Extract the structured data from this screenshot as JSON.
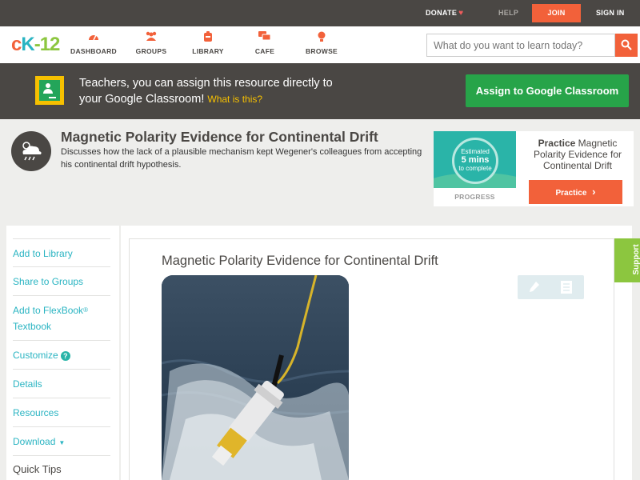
{
  "topbar": {
    "donate": "DONATE",
    "help": "HELP",
    "join": "JOIN",
    "signin": "SIGN IN"
  },
  "brand": {
    "logo_c": "c",
    "logo_k": "K",
    "logo_rest": "-12"
  },
  "nav": {
    "items": [
      {
        "label": "DASHBOARD",
        "icon": "dashboard-icon"
      },
      {
        "label": "GROUPS",
        "icon": "groups-icon"
      },
      {
        "label": "LIBRARY",
        "icon": "library-icon"
      },
      {
        "label": "CAFE",
        "icon": "cafe-icon"
      },
      {
        "label": "BROWSE",
        "icon": "browse-icon"
      }
    ],
    "search_placeholder": "What do you want to learn today?"
  },
  "banner": {
    "line1": "Teachers, you can assign this resource directly to",
    "line2": "your Google Classroom!",
    "what_link": "What is this?",
    "assign_button": "Assign to Google Classroom"
  },
  "header": {
    "title": "Magnetic Polarity Evidence for Continental Drift",
    "description": "Discusses how the lack of a plausible mechanism kept Wegener's colleagues from accepting his continental drift hypothesis."
  },
  "practice": {
    "estimated": "Estimated",
    "minutes": "5 mins",
    "to_complete": "to complete",
    "progress_label": "PROGRESS",
    "title_bold": "Practice",
    "title_rest": "Magnetic Polarity Evidence for Continental Drift",
    "button": "Practice"
  },
  "sidebar": {
    "items": [
      {
        "label": "Add to Library"
      },
      {
        "label": "Share to Groups"
      },
      {
        "label": "Add to FlexBook",
        "sup": "®",
        "line2": "Textbook"
      },
      {
        "label": "Customize"
      },
      {
        "label": "Details"
      },
      {
        "label": "Resources"
      },
      {
        "label": "Download"
      }
    ],
    "quick_tips": "Quick Tips"
  },
  "content": {
    "title": "Magnetic Polarity Evidence for Continental Drift"
  },
  "support_tab": "Support",
  "colors": {
    "accent_orange": "#f2613a",
    "dark_gray": "#4a4744",
    "teal": "#2ab4c2",
    "green": "#27a449",
    "support_green": "#8cc63f"
  }
}
